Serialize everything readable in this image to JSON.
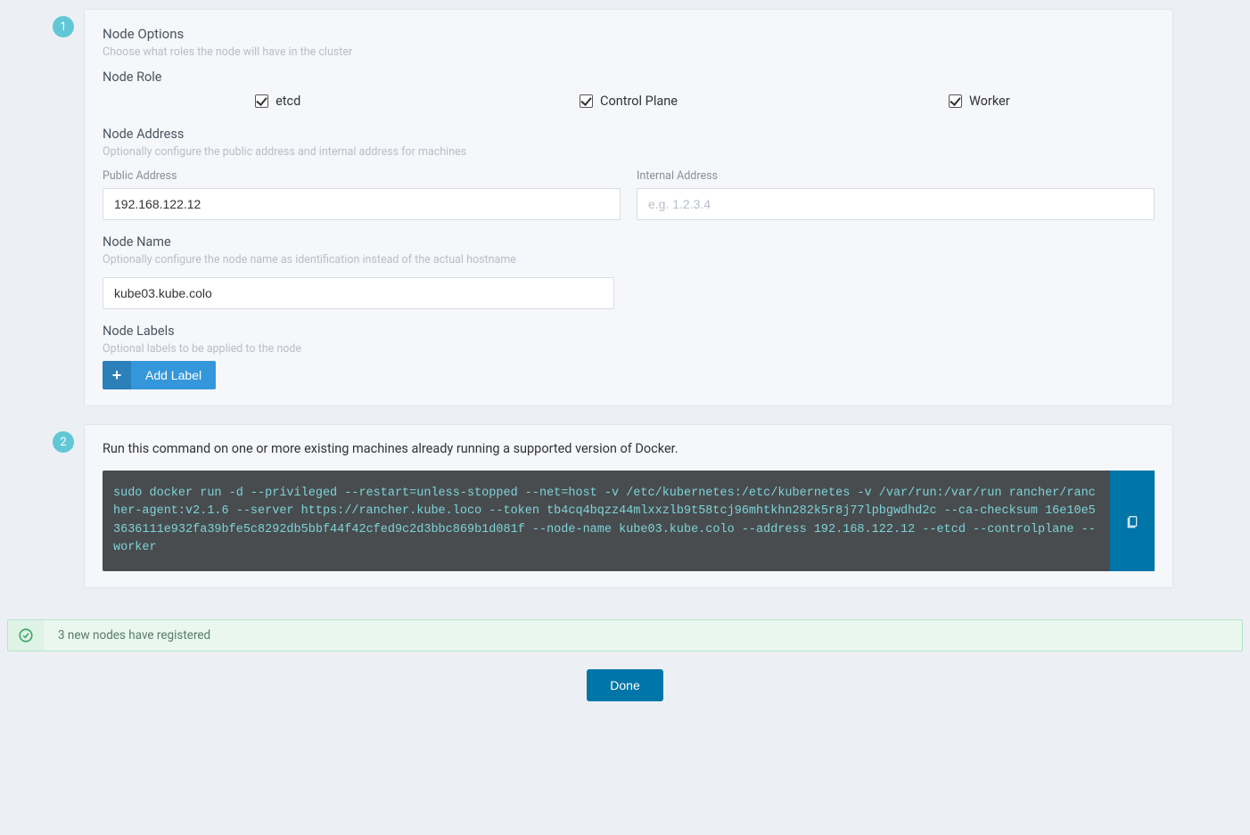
{
  "step1": {
    "badge": "1",
    "title": "Node Options",
    "subtitle": "Choose what roles the node will have in the cluster",
    "role_header": "Node Role",
    "roles": {
      "etcd": "etcd",
      "control": "Control Plane",
      "worker": "Worker"
    },
    "address": {
      "header": "Node Address",
      "sub": "Optionally configure the public address and internal address for machines",
      "public_label": "Public Address",
      "public_value": "192.168.122.12",
      "internal_label": "Internal Address",
      "internal_placeholder": "e.g. 1.2.3.4"
    },
    "name": {
      "header": "Node Name",
      "sub": "Optionally configure the node name as identification instead of the actual hostname",
      "value": "kube03.kube.colo"
    },
    "labels": {
      "header": "Node Labels",
      "sub": "Optional labels to be applied to the node",
      "add_btn": "Add Label"
    }
  },
  "step2": {
    "badge": "2",
    "run_text": "Run this command on one or more existing machines already running a supported version of Docker.",
    "command": "sudo docker run -d --privileged --restart=unless-stopped --net=host -v /etc/kubernetes:/etc/kubernetes -v /var/run:/var/run rancher/rancher-agent:v2.1.6 --server https://rancher.kube.loco --token tb4cq4bqzz44mlxxzlb9t58tcj96mhtkhn282k5r8j77lpbgwdhd2c --ca-checksum 16e10e53636111e932fa39bfe5c8292db5bbf44f42cfed9c2d3bbc869b1d081f --node-name kube03.kube.colo --address 192.168.122.12 --etcd --controlplane --worker"
  },
  "notification": "3 new nodes have registered",
  "done": "Done"
}
